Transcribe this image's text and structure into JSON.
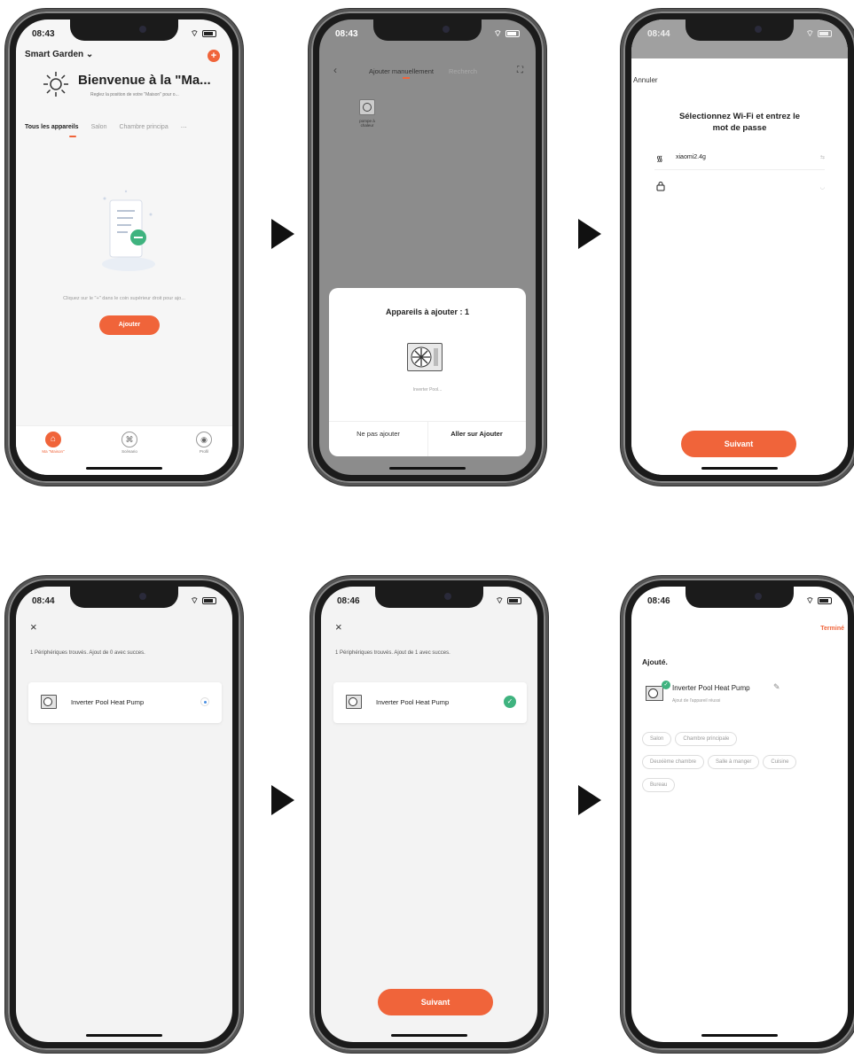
{
  "colors": {
    "accent": "#f0643a",
    "success": "#3fb37f",
    "selected_blue": "#4a90e2",
    "overlay": "#8c8c8c"
  },
  "s1": {
    "time": "08:43",
    "home_selector": "Smart Garden",
    "welcome_title": "Bienvenue à la \"Ma...",
    "welcome_sub": "Reglez la position de votre \"Maison\" pour o...",
    "tabs": [
      "Tous les appareils",
      "Salon",
      "Chambre principa"
    ],
    "more_tabs": "⋯",
    "empty_hint": "Cliquez sur le \"+\" dans le coin supérieur droit pour ajo...",
    "add_button": "Ajouter",
    "nav": [
      "Ma \"Maison\"",
      "Scénario",
      "Profil"
    ]
  },
  "s2": {
    "time": "08:43",
    "tab_active": "Ajouter manuellement",
    "tab_other": "Recherch",
    "device_caption": [
      "pompe à",
      "chaleur"
    ],
    "sheet_title": "Appareils à ajouter : 1",
    "device_name": "Inverter Pool...",
    "btn_no": "Ne pas ajouter",
    "btn_yes": "Aller sur Ajouter"
  },
  "s3": {
    "time": "08:44",
    "cancel": "Annuler",
    "heading_line1": "Sélectionnez Wi-Fi et entrez le",
    "heading_line2": "mot de passe",
    "wifi_value": "xiaomi2.4g",
    "password_value": "",
    "next": "Suivant"
  },
  "s4": {
    "time": "08:44",
    "found_text": "1 Périphériques trouvés. Ajout de 0 avec succes.",
    "device": "Inverter Pool Heat Pump"
  },
  "s5": {
    "time": "08:46",
    "found_text": "1 Périphériques trouvés. Ajout de 1 avec succes.",
    "device": "Inverter Pool Heat Pump",
    "next": "Suivant"
  },
  "s6": {
    "time": "08:46",
    "done": "Terminé",
    "added": "Ajouté.",
    "device": "Inverter Pool Heat Pump",
    "device_sub": "Ajout de l'appareil réussi",
    "rooms": [
      "Salon",
      "Chambre principale",
      "Deuxième chambre",
      "Salle à manger",
      "Cuisine",
      "Bureau"
    ]
  }
}
